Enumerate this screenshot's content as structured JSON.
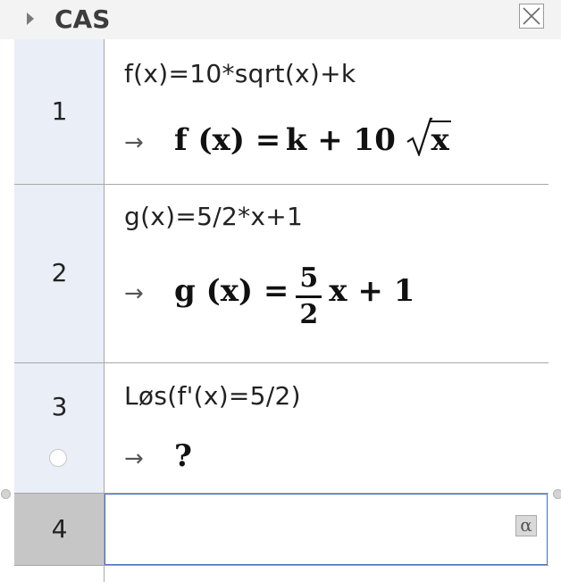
{
  "header": {
    "title": "CAS"
  },
  "rows": [
    {
      "number": "1",
      "input": "f(x)=10*sqrt(x)+k",
      "output": {
        "arrow": "→",
        "lhs": "f (x) =",
        "expr_a": "k + 10",
        "sqrt_arg": "x"
      }
    },
    {
      "number": "2",
      "input": "g(x)=5/2*x+1",
      "output": {
        "arrow": "→",
        "lhs": "g (x) =",
        "frac_num": "5",
        "frac_den": "2",
        "rest": "x + 1"
      }
    },
    {
      "number": "3",
      "input": "Løs(f'(x)=5/2)",
      "output": {
        "arrow": "→",
        "value": "?"
      }
    },
    {
      "number": "4",
      "input": "",
      "alpha_symbol": "α"
    }
  ],
  "colors": {
    "row_header_bg": "#e9eef7",
    "active_row_header_bg": "#c6c6c6",
    "active_border": "#3f6fb8"
  }
}
